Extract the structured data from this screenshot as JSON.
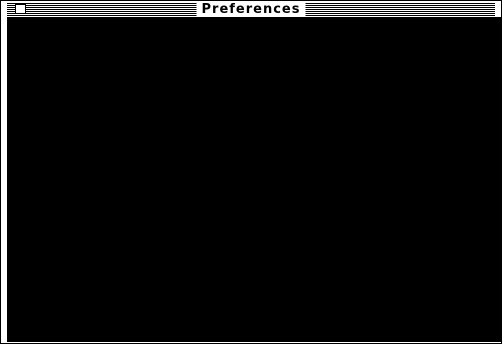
{
  "window": {
    "title": "Preferences"
  },
  "colors": {
    "background": "#ffffff",
    "content": "#000000",
    "title_stripes": "#000000"
  },
  "icons": {
    "close_box": "close-box-icon"
  }
}
